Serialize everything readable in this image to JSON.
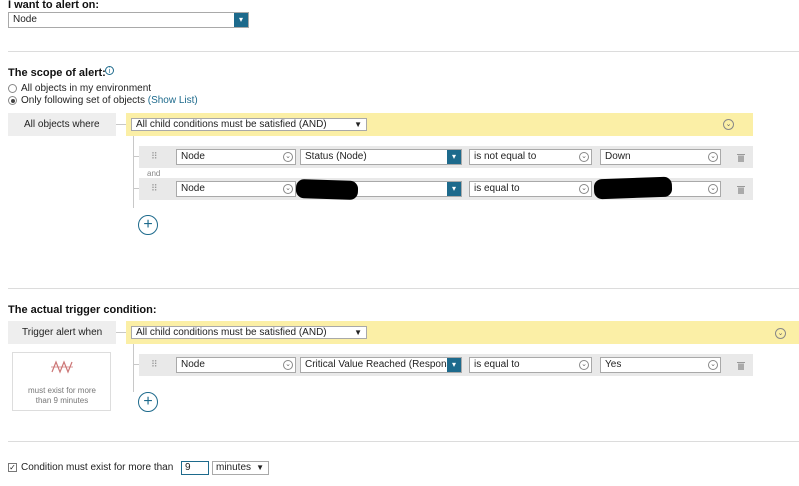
{
  "alert_on": {
    "label": "I want to alert on:",
    "value": "Node"
  },
  "scope": {
    "heading": "The scope of alert:",
    "radio_all": "All objects in my environment",
    "radio_following": "Only following set of objects",
    "show_list": "(Show List)",
    "left_label": "All objects where",
    "group_value": "All child conditions must be satisfied (AND)",
    "and_label": "and",
    "conditions": [
      {
        "object": "Node",
        "field": "Status (Node)",
        "operator": "is not equal to",
        "value": "Down"
      },
      {
        "object": "Node",
        "field": "",
        "operator": "is equal to",
        "value": ""
      }
    ]
  },
  "trigger": {
    "heading": "The actual trigger condition:",
    "left_label": "Trigger alert when",
    "group_value": "All child conditions must be satisfied (AND)",
    "icon_text": "must exist for more than 9 minutes",
    "conditions": [
      {
        "object": "Node",
        "field": "Critical Value Reached (Respons",
        "operator": "is equal to",
        "value": "Yes"
      }
    ]
  },
  "bottom": {
    "label": "Condition must exist for more than",
    "value": "9",
    "unit": "minutes"
  }
}
